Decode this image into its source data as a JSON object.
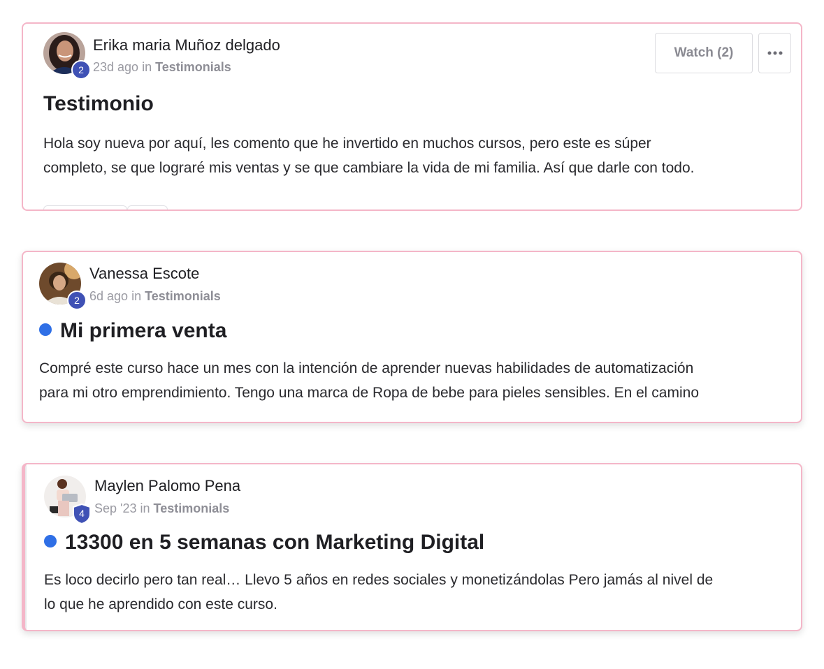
{
  "posts": [
    {
      "author": "Erika maria Muñoz delgado",
      "level": "2",
      "time": "23d ago",
      "in_word": "in",
      "category": "Testimonials",
      "title": "Testimonio",
      "body_line1": "Hola soy nueva por aquí, les comento que he invertido en muchos cursos, pero este es súper",
      "body_line2": "completo, se que lograré mis ventas y se que cambiare la vida de mi familia. Así que darle con todo.",
      "watch_label": "Watch (2)",
      "more_icon": "more-horizontal-icon",
      "unread": false
    },
    {
      "author": "Vanessa Escote",
      "level": "2",
      "time": "6d ago",
      "in_word": "in",
      "category": "Testimonials",
      "title": "Mi primera venta",
      "body_line1": "Compré este curso hace un mes con la intención de aprender nuevas habilidades de automatización",
      "body_line2": "para mi otro emprendimiento. Tengo una marca de Ropa de bebe para pieles sensibles. En el camino",
      "unread": true
    },
    {
      "author": "Maylen Palomo Pena",
      "level": "4",
      "time": "Sep '23",
      "in_word": "in",
      "category": "Testimonials",
      "title": "13300 en 5 semanas con Marketing Digital",
      "body_line1": "Es loco decirlo pero tan real… Llevo 5 años en redes sociales y monetizándolas Pero jamás al nivel de",
      "body_line2": "lo que he aprendido con este curso.",
      "unread": true
    }
  ],
  "colors": {
    "card_border": "#f4b6c8",
    "unread_dot": "#2f6fe6",
    "level_badge": "#3f51b5",
    "meta_text": "#9a9aa2"
  }
}
